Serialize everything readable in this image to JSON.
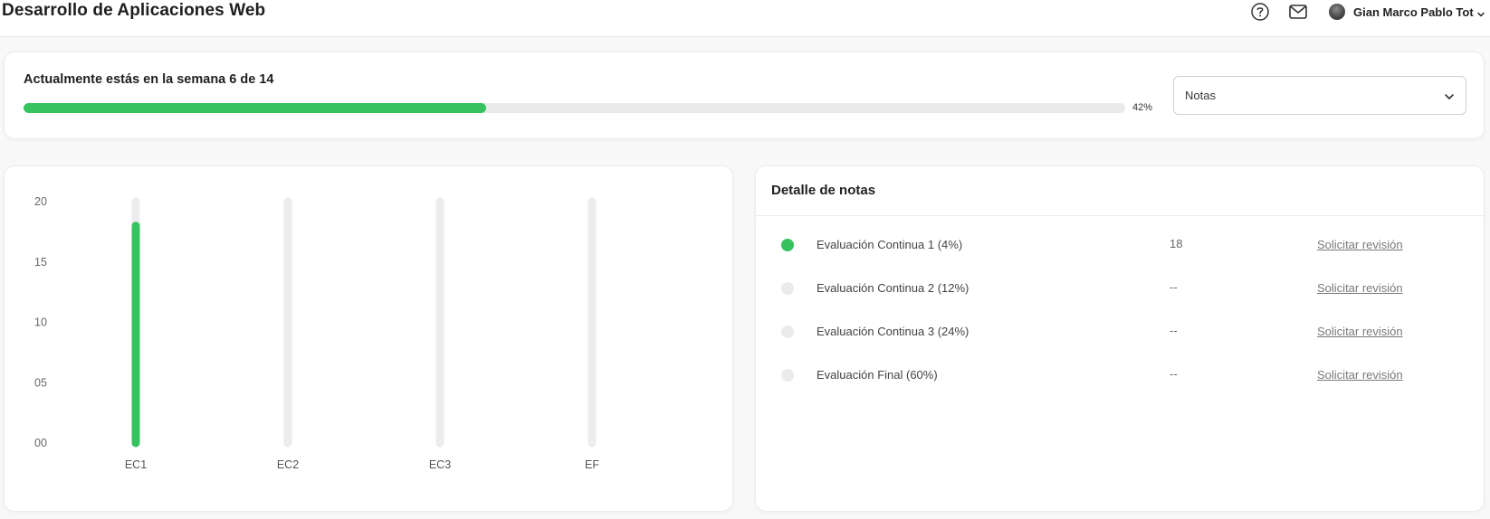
{
  "header": {
    "title": "Desarrollo de Aplicaciones Web",
    "help_icon": "question-circle-icon",
    "mail_icon": "envelope-icon",
    "user_name": "Gian Marco Pablo Tot",
    "user_chevron_icon": "chevron-down-icon"
  },
  "week": {
    "text": "Actualmente estás en la semana 6 de 14",
    "progress_percent": 42,
    "progress_label": "42%",
    "progress_color": "#36c25f"
  },
  "view_select": {
    "value": "Notas",
    "chevron_icon": "chevron-down-icon"
  },
  "chart_data": {
    "type": "bar",
    "categories": [
      "EC1",
      "EC2",
      "EC3",
      "EF"
    ],
    "values": [
      18,
      null,
      null,
      null
    ],
    "ylim": [
      0,
      20
    ],
    "yticks": [
      "00",
      "05",
      "10",
      "15",
      "20"
    ],
    "ytick_values": [
      0,
      5,
      10,
      15,
      20
    ],
    "title": "",
    "xlabel": "",
    "ylabel": "",
    "bar_color": "#36c25f",
    "track_color": "#ececec",
    "grid": false
  },
  "details": {
    "title": "Detalle de notas",
    "rows": [
      {
        "name": "Evaluación Continua 1 (4%)",
        "score": "18",
        "link": "Solicitar revisión",
        "status_color": "#36c25f"
      },
      {
        "name": "Evaluación Continua 2 (12%)",
        "score": "--",
        "link": "Solicitar revisión",
        "status_color": "#ebebeb"
      },
      {
        "name": "Evaluación Continua 3 (24%)",
        "score": "--",
        "link": "Solicitar revisión",
        "status_color": "#ebebeb"
      },
      {
        "name": "Evaluación Final (60%)",
        "score": "--",
        "link": "Solicitar revisión",
        "status_color": "#ebebeb"
      }
    ]
  }
}
